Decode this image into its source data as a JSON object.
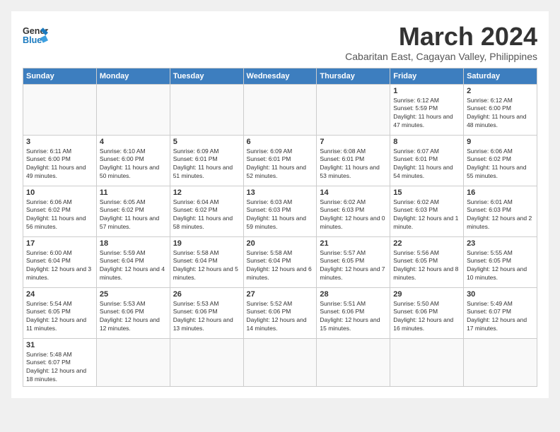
{
  "header": {
    "logo_line1": "General",
    "logo_line2": "Blue",
    "month_title": "March 2024",
    "subtitle": "Cabaritan East, Cagayan Valley, Philippines"
  },
  "weekdays": [
    "Sunday",
    "Monday",
    "Tuesday",
    "Wednesday",
    "Thursday",
    "Friday",
    "Saturday"
  ],
  "weeks": [
    [
      {
        "day": "",
        "info": ""
      },
      {
        "day": "",
        "info": ""
      },
      {
        "day": "",
        "info": ""
      },
      {
        "day": "",
        "info": ""
      },
      {
        "day": "",
        "info": ""
      },
      {
        "day": "1",
        "info": "Sunrise: 6:12 AM\nSunset: 5:59 PM\nDaylight: 11 hours\nand 47 minutes."
      },
      {
        "day": "2",
        "info": "Sunrise: 6:12 AM\nSunset: 6:00 PM\nDaylight: 11 hours\nand 48 minutes."
      }
    ],
    [
      {
        "day": "3",
        "info": "Sunrise: 6:11 AM\nSunset: 6:00 PM\nDaylight: 11 hours\nand 49 minutes."
      },
      {
        "day": "4",
        "info": "Sunrise: 6:10 AM\nSunset: 6:00 PM\nDaylight: 11 hours\nand 50 minutes."
      },
      {
        "day": "5",
        "info": "Sunrise: 6:09 AM\nSunset: 6:01 PM\nDaylight: 11 hours\nand 51 minutes."
      },
      {
        "day": "6",
        "info": "Sunrise: 6:09 AM\nSunset: 6:01 PM\nDaylight: 11 hours\nand 52 minutes."
      },
      {
        "day": "7",
        "info": "Sunrise: 6:08 AM\nSunset: 6:01 PM\nDaylight: 11 hours\nand 53 minutes."
      },
      {
        "day": "8",
        "info": "Sunrise: 6:07 AM\nSunset: 6:01 PM\nDaylight: 11 hours\nand 54 minutes."
      },
      {
        "day": "9",
        "info": "Sunrise: 6:06 AM\nSunset: 6:02 PM\nDaylight: 11 hours\nand 55 minutes."
      }
    ],
    [
      {
        "day": "10",
        "info": "Sunrise: 6:06 AM\nSunset: 6:02 PM\nDaylight: 11 hours\nand 56 minutes."
      },
      {
        "day": "11",
        "info": "Sunrise: 6:05 AM\nSunset: 6:02 PM\nDaylight: 11 hours\nand 57 minutes."
      },
      {
        "day": "12",
        "info": "Sunrise: 6:04 AM\nSunset: 6:02 PM\nDaylight: 11 hours\nand 58 minutes."
      },
      {
        "day": "13",
        "info": "Sunrise: 6:03 AM\nSunset: 6:03 PM\nDaylight: 11 hours\nand 59 minutes."
      },
      {
        "day": "14",
        "info": "Sunrise: 6:02 AM\nSunset: 6:03 PM\nDaylight: 12 hours\nand 0 minutes."
      },
      {
        "day": "15",
        "info": "Sunrise: 6:02 AM\nSunset: 6:03 PM\nDaylight: 12 hours\nand 1 minute."
      },
      {
        "day": "16",
        "info": "Sunrise: 6:01 AM\nSunset: 6:03 PM\nDaylight: 12 hours\nand 2 minutes."
      }
    ],
    [
      {
        "day": "17",
        "info": "Sunrise: 6:00 AM\nSunset: 6:04 PM\nDaylight: 12 hours\nand 3 minutes."
      },
      {
        "day": "18",
        "info": "Sunrise: 5:59 AM\nSunset: 6:04 PM\nDaylight: 12 hours\nand 4 minutes."
      },
      {
        "day": "19",
        "info": "Sunrise: 5:58 AM\nSunset: 6:04 PM\nDaylight: 12 hours\nand 5 minutes."
      },
      {
        "day": "20",
        "info": "Sunrise: 5:58 AM\nSunset: 6:04 PM\nDaylight: 12 hours\nand 6 minutes."
      },
      {
        "day": "21",
        "info": "Sunrise: 5:57 AM\nSunset: 6:05 PM\nDaylight: 12 hours\nand 7 minutes."
      },
      {
        "day": "22",
        "info": "Sunrise: 5:56 AM\nSunset: 6:05 PM\nDaylight: 12 hours\nand 8 minutes."
      },
      {
        "day": "23",
        "info": "Sunrise: 5:55 AM\nSunset: 6:05 PM\nDaylight: 12 hours\nand 10 minutes."
      }
    ],
    [
      {
        "day": "24",
        "info": "Sunrise: 5:54 AM\nSunset: 6:05 PM\nDaylight: 12 hours\nand 11 minutes."
      },
      {
        "day": "25",
        "info": "Sunrise: 5:53 AM\nSunset: 6:06 PM\nDaylight: 12 hours\nand 12 minutes."
      },
      {
        "day": "26",
        "info": "Sunrise: 5:53 AM\nSunset: 6:06 PM\nDaylight: 12 hours\nand 13 minutes."
      },
      {
        "day": "27",
        "info": "Sunrise: 5:52 AM\nSunset: 6:06 PM\nDaylight: 12 hours\nand 14 minutes."
      },
      {
        "day": "28",
        "info": "Sunrise: 5:51 AM\nSunset: 6:06 PM\nDaylight: 12 hours\nand 15 minutes."
      },
      {
        "day": "29",
        "info": "Sunrise: 5:50 AM\nSunset: 6:06 PM\nDaylight: 12 hours\nand 16 minutes."
      },
      {
        "day": "30",
        "info": "Sunrise: 5:49 AM\nSunset: 6:07 PM\nDaylight: 12 hours\nand 17 minutes."
      }
    ],
    [
      {
        "day": "31",
        "info": "Sunrise: 5:48 AM\nSunset: 6:07 PM\nDaylight: 12 hours\nand 18 minutes."
      },
      {
        "day": "",
        "info": ""
      },
      {
        "day": "",
        "info": ""
      },
      {
        "day": "",
        "info": ""
      },
      {
        "day": "",
        "info": ""
      },
      {
        "day": "",
        "info": ""
      },
      {
        "day": "",
        "info": ""
      }
    ]
  ]
}
